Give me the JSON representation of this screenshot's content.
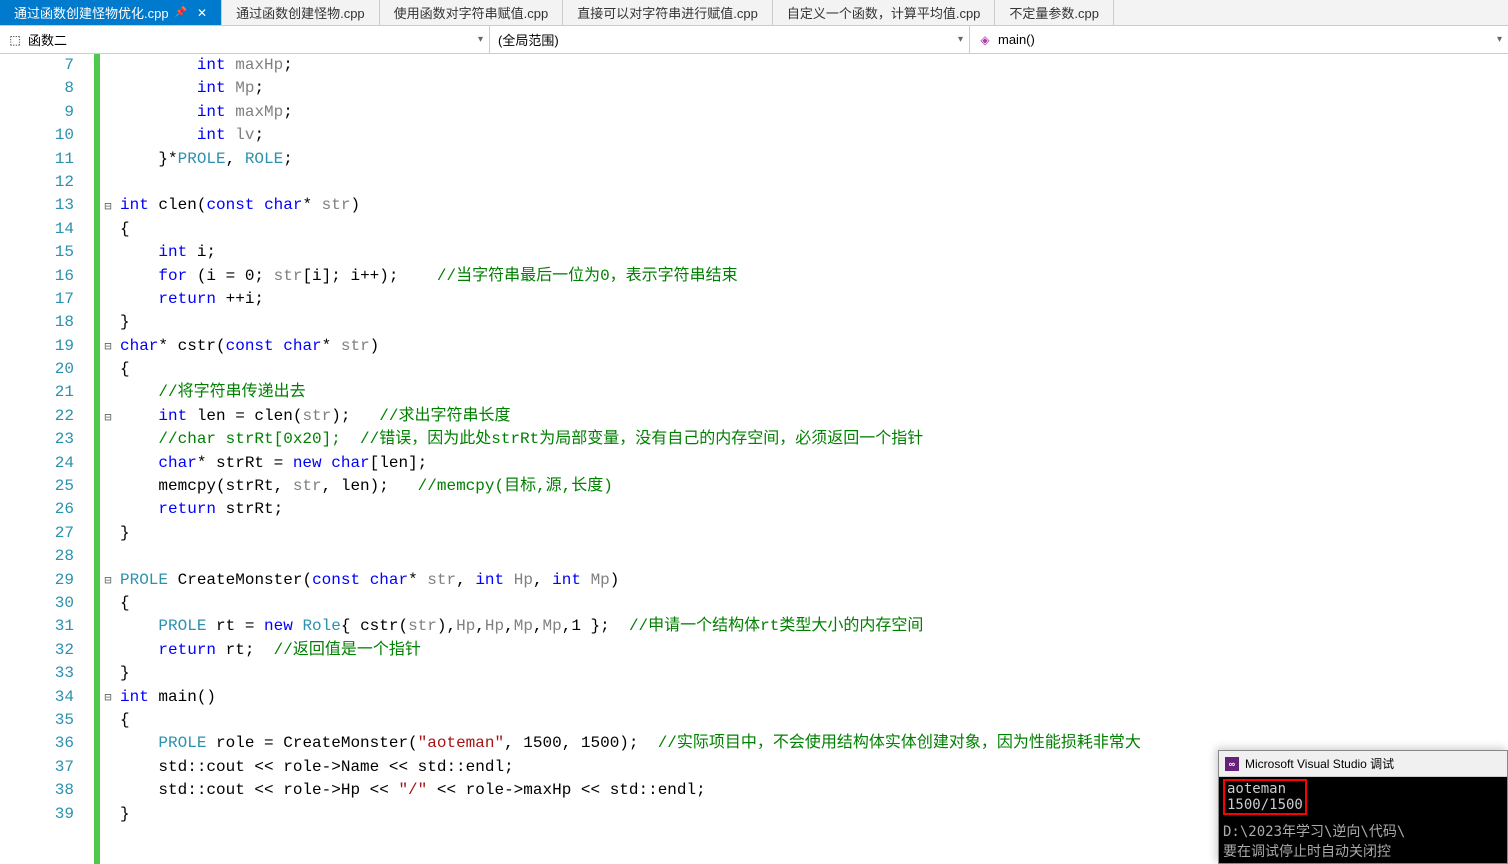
{
  "tabs": [
    {
      "label": "通过函数创建怪物优化.cpp",
      "active": true,
      "pinned": true,
      "closable": true
    },
    {
      "label": "通过函数创建怪物.cpp"
    },
    {
      "label": "使用函数对字符串赋值.cpp"
    },
    {
      "label": "直接可以对字符串进行赋值.cpp"
    },
    {
      "label": "自定义一个函数，计算平均值.cpp"
    },
    {
      "label": "不定量参数.cpp"
    }
  ],
  "nav": {
    "project": "函数二",
    "scope": "(全局范围)",
    "member": "main()"
  },
  "first_line_number": 7,
  "fold_markers": {
    "13": "⊟",
    "19": "⊟",
    "22": "⊟",
    "29": "⊟",
    "34": "⊟"
  },
  "code_lines": [
    {
      "n": 7,
      "html": "        <span class='kw'>int</span> <span class='gry'>maxHp</span>;"
    },
    {
      "n": 8,
      "html": "        <span class='kw'>int</span> <span class='gry'>Mp</span>;"
    },
    {
      "n": 9,
      "html": "        <span class='kw'>int</span> <span class='gry'>maxMp</span>;"
    },
    {
      "n": 10,
      "html": "        <span class='kw'>int</span> <span class='gry'>lv</span>;"
    },
    {
      "n": 11,
      "html": "    }*<span class='typ'>PROLE</span>, <span class='typ'>ROLE</span>;"
    },
    {
      "n": 12,
      "html": ""
    },
    {
      "n": 13,
      "html": "<span class='kw'>int</span> <span class='func'>clen</span>(<span class='kw'>const</span> <span class='kw'>char</span>* <span class='gry'>str</span>)"
    },
    {
      "n": 14,
      "html": "{"
    },
    {
      "n": 15,
      "html": "    <span class='kw'>int</span> i;"
    },
    {
      "n": 16,
      "html": "    <span class='kw'>for</span> (i = 0; <span class='gry'>str</span>[i]; i++);    <span class='com'>//当字符串最后一位为0，表示字符串结束</span>"
    },
    {
      "n": 17,
      "html": "    <span class='kw'>return</span> ++i;"
    },
    {
      "n": 18,
      "html": "}"
    },
    {
      "n": 19,
      "html": "<span class='kw'>char</span>* <span class='func'>cstr</span>(<span class='kw'>const</span> <span class='kw'>char</span>* <span class='gry'>str</span>)"
    },
    {
      "n": 20,
      "html": "{"
    },
    {
      "n": 21,
      "html": "    <span class='com'>//将字符串传递出去</span>"
    },
    {
      "n": 22,
      "html": "    <span class='kw'>int</span> len = clen(<span class='gry'>str</span>);   <span class='com'>//求出字符串长度</span>"
    },
    {
      "n": 23,
      "html": "    <span class='com'>//char strRt[0x20];  //错误，因为此处strRt为局部变量，没有自己的内存空间，必须返回一个指针</span>"
    },
    {
      "n": 24,
      "html": "    <span class='kw'>char</span>* strRt = <span class='kw'>new</span> <span class='kw'>char</span>[len];"
    },
    {
      "n": 25,
      "html": "    memcpy(strRt, <span class='gry'>str</span>, len);   <span class='com'>//memcpy(目标,源,长度)</span>"
    },
    {
      "n": 26,
      "html": "    <span class='kw'>return</span> strRt;"
    },
    {
      "n": 27,
      "html": "}"
    },
    {
      "n": 28,
      "html": ""
    },
    {
      "n": 29,
      "html": "<span class='typ'>PROLE</span> <span class='func'>CreateMonster</span>(<span class='kw'>const</span> <span class='kw'>char</span>* <span class='gry'>str</span>, <span class='kw'>int</span> <span class='gry'>Hp</span>, <span class='kw'>int</span> <span class='gry'>Mp</span>)"
    },
    {
      "n": 30,
      "html": "{"
    },
    {
      "n": 31,
      "html": "    <span class='typ'>PROLE</span> rt = <span class='kw'>new</span> <span class='typ'>Role</span>{ cstr(<span class='gry'>str</span>),<span class='gry'>Hp</span>,<span class='gry'>Hp</span>,<span class='gry'>Mp</span>,<span class='gry'>Mp</span>,1 };  <span class='com'>//申请一个结构体rt类型大小的内存空间</span>"
    },
    {
      "n": 32,
      "html": "    <span class='kw'>return</span> rt;  <span class='com'>//返回值是一个指针</span>"
    },
    {
      "n": 33,
      "html": "}"
    },
    {
      "n": 34,
      "html": "<span class='kw'>int</span> <span class='func'>main</span>()"
    },
    {
      "n": 35,
      "html": "{"
    },
    {
      "n": 36,
      "html": "    <span class='typ'>PROLE</span> role = CreateMonster(<span class='str'>\"aoteman\"</span>, 1500, 1500);  <span class='com'>//实际项目中，不会使用结构体实体创建对象，因为性能损耗非常大</span>"
    },
    {
      "n": 37,
      "html": "    std::cout &lt;&lt; role-&gt;Name &lt;&lt; std::endl;"
    },
    {
      "n": 38,
      "html": "    std::cout &lt;&lt; role-&gt;Hp &lt;&lt; <span class='str'>\"/\"</span> &lt;&lt; role-&gt;maxHp &lt;&lt; std::endl;"
    },
    {
      "n": 39,
      "html": "}"
    }
  ],
  "console": {
    "title": "Microsoft Visual Studio 调试",
    "highlight_lines": [
      "aoteman",
      "1500/1500"
    ],
    "path_line": "D:\\2023年学习\\逆向\\代码\\",
    "bottom_text": "要在调试停止时自动关闭控"
  }
}
